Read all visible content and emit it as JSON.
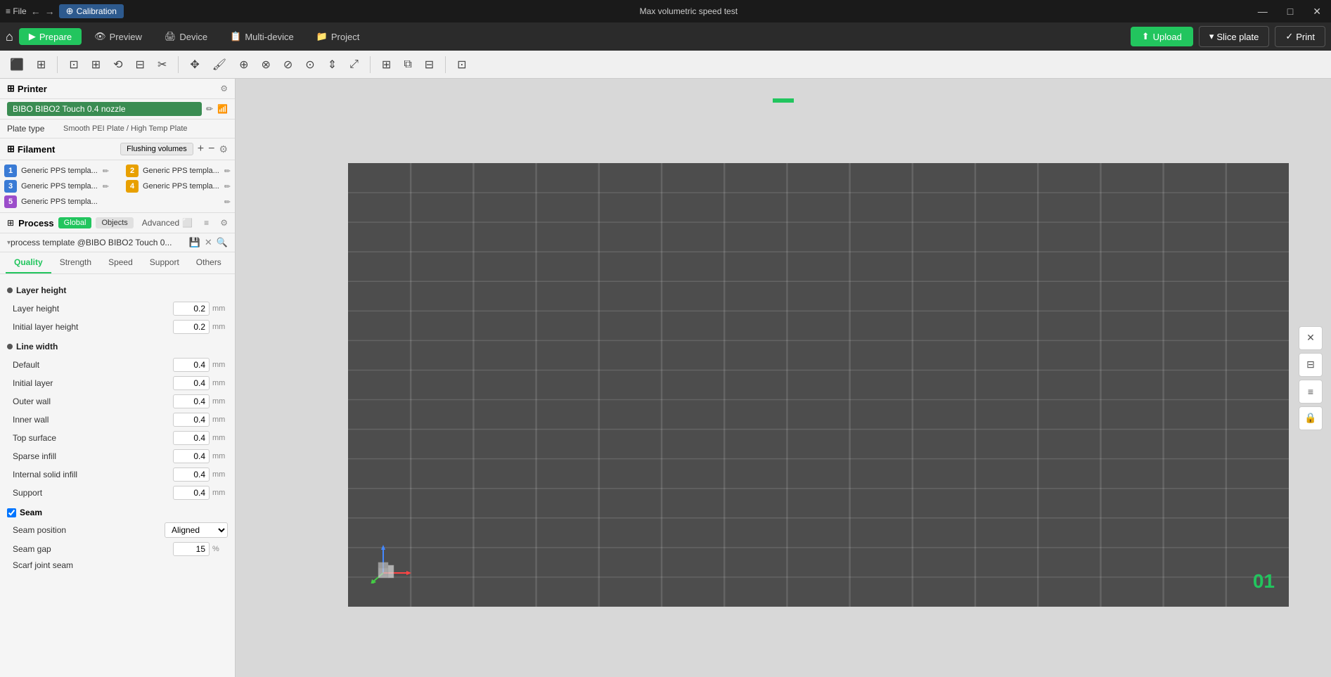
{
  "window": {
    "title": "Max volumetric speed test",
    "menu_file": "≡  File",
    "win_minimize": "—",
    "win_maximize": "□",
    "win_close": "✕"
  },
  "titlebar": {
    "back_icon": "←",
    "forward_icon": "→",
    "calibration_label": "Calibration"
  },
  "navbar": {
    "home_icon": "⌂",
    "tabs": [
      {
        "id": "prepare",
        "label": "Prepare",
        "active": true,
        "icon": "▶"
      },
      {
        "id": "preview",
        "label": "Preview",
        "icon": "👁"
      },
      {
        "id": "device",
        "label": "Device",
        "icon": "🖨"
      },
      {
        "id": "multi-device",
        "label": "Multi-device",
        "icon": "📋"
      },
      {
        "id": "project",
        "label": "Project",
        "icon": "📁"
      }
    ],
    "upload_label": "Upload",
    "slice_label": "Slice plate",
    "print_label": "Print"
  },
  "printer": {
    "section_label": "Printer",
    "name": "BIBO BIBO2 Touch 0.4 nozzle",
    "plate_type_label": "Plate type",
    "plate_type_value": "Smooth PEI Plate / High Temp Plate"
  },
  "filament": {
    "section_label": "Filament",
    "flush_btn": "Flushing volumes",
    "items": [
      {
        "num": "1",
        "color": "#3a7bd5",
        "name": "Generic PPS templa..."
      },
      {
        "num": "2",
        "color": "#e8a000",
        "name": "Generic PPS templa..."
      },
      {
        "num": "3",
        "color": "#3a7bd5",
        "name": "Generic PPS templa..."
      },
      {
        "num": "4",
        "color": "#e8a000",
        "name": "Generic PPS templa..."
      },
      {
        "num": "5",
        "color": "#9b4dca",
        "name": "Generic PPS templa..."
      }
    ]
  },
  "process": {
    "section_label": "Process",
    "tab_global": "Global",
    "tab_objects": "Objects",
    "advanced_label": "Advanced",
    "template_name": "process template @BIBO BIBO2 Touch 0...",
    "quality_tabs": [
      "Quality",
      "Strength",
      "Speed",
      "Support",
      "Others"
    ]
  },
  "quality": {
    "layer_height_section": "Layer height",
    "layer_height_label": "Layer height",
    "layer_height_value": "0.2",
    "layer_height_unit": "mm",
    "initial_layer_height_label": "Initial layer height",
    "initial_layer_height_value": "0.2",
    "initial_layer_height_unit": "mm",
    "line_width_section": "Line width",
    "line_width_items": [
      {
        "label": "Default",
        "value": "0.4",
        "unit": "mm"
      },
      {
        "label": "Initial layer",
        "value": "0.4",
        "unit": "mm"
      },
      {
        "label": "Outer wall",
        "value": "0.4",
        "unit": "mm"
      },
      {
        "label": "Inner wall",
        "value": "0.4",
        "unit": "mm"
      },
      {
        "label": "Top surface",
        "value": "0.4",
        "unit": "mm"
      },
      {
        "label": "Sparse infill",
        "value": "0.4",
        "unit": "mm"
      },
      {
        "label": "Internal solid infill",
        "value": "0.4",
        "unit": "mm"
      },
      {
        "label": "Support",
        "value": "0.4",
        "unit": "mm"
      }
    ],
    "seam_section": "Seam",
    "seam_position_label": "Seam position",
    "seam_position_value": "Aligned",
    "seam_gap_label": "Seam gap",
    "seam_gap_value": "15",
    "seam_gap_unit": "%",
    "scarf_joint_seam_label": "Scarf joint seam"
  },
  "viewport": {
    "plate_number": "01"
  },
  "icons": {
    "grid": "⊞",
    "settings": "⚙",
    "wifi": "📶",
    "edit": "✏",
    "add": "+",
    "remove": "−",
    "save": "💾",
    "close_x": "✕",
    "search": "🔍",
    "expand": "▼",
    "chevron_right": "›",
    "layers": "≡",
    "cube": "⬜",
    "move": "✥",
    "rotate": "↻",
    "scale": "⤢",
    "mirror": "⇔",
    "paint": "🖌",
    "cut": "✂",
    "copy": "⧉",
    "delete": "🗑",
    "reset": "↺",
    "screenshot": "📷",
    "lock": "🔒"
  }
}
